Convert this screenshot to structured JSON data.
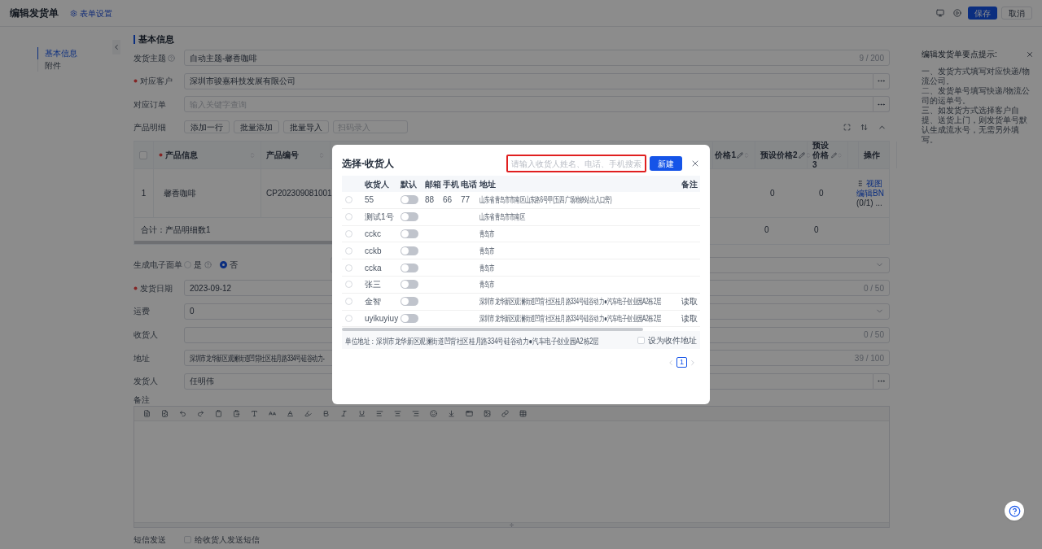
{
  "header": {
    "title": "编辑发货单",
    "settings_link": "表单设置",
    "save": "保存",
    "cancel": "取消"
  },
  "nav": [
    {
      "label": "基本信息",
      "selected": true
    },
    {
      "label": "附件",
      "selected": false
    }
  ],
  "section_title": "基本信息",
  "top_fields": [
    {
      "kind": "text",
      "label": "发货主题",
      "required": false,
      "help": true,
      "value": "自动主题-馨香咖啡",
      "counter": "9 / 200"
    },
    {
      "kind": "lookup",
      "label": "对应客户",
      "required": true,
      "help": false,
      "value": "深圳市骏嘉科技发展有限公司"
    },
    {
      "kind": "lookup",
      "label": "对应订单",
      "required": false,
      "help": false,
      "placeholder": "输入关键字查询"
    }
  ],
  "products": {
    "label": "产品明细",
    "select_all_checked": false,
    "buttons": [
      "添加一行",
      "批量添加",
      "批量导入"
    ],
    "scan_placeholder": "扫码录入",
    "columns": [
      {
        "label": "产品信息",
        "required": true
      },
      {
        "label": "产品编号",
        "required": false
      },
      {
        "label": "价格1"
      },
      {
        "label": "预设价格2"
      },
      {
        "label": "预设价格3"
      },
      {
        "label": "操作"
      }
    ],
    "rows": [
      {
        "index": "1",
        "product": "馨香咖啡",
        "code": "CP202309081001",
        "price2": "0",
        "price3": "0",
        "actions": [
          "视图",
          "编辑BN"
        ],
        "count": "(0/1)",
        "more": "..."
      }
    ],
    "footer": {
      "label": "合计：产品明细数1",
      "price2": "0",
      "price3": "0"
    }
  },
  "bottom_fields": [
    {
      "kind": "radio",
      "label": "生成电子面单",
      "required": false,
      "options": [
        {
          "label": "是",
          "help": true,
          "selected": false
        },
        {
          "label": "否",
          "help": false,
          "selected": true
        }
      ]
    },
    {
      "kind": "text",
      "label": "发货日期",
      "required": true,
      "value": "2023-09-12",
      "counter": "0 / 50"
    },
    {
      "kind": "select",
      "label": "运费",
      "required": false,
      "value": "0"
    },
    {
      "kind": "text",
      "label": "收货人",
      "required": false,
      "counter": "0 / 50"
    },
    {
      "kind": "text",
      "label": "地址",
      "required": false,
      "value": "深圳市龙华新区观澜街道凹背社区桂月路334号硅谷动力-",
      "counter": "39 / 100"
    },
    {
      "kind": "lookup",
      "label": "发货人",
      "required": false,
      "value": "任明伟"
    }
  ],
  "remark": {
    "label": "备注"
  },
  "sms": {
    "label": "短信发送",
    "checkbox_label": "给收货人发送短信",
    "checked": false
  },
  "tips": {
    "title": "编辑发货单要点提示:",
    "paragraphs": [
      "一、发货方式填写对应快递/物流公司。",
      "二、发货单号填写快递/物流公司的运单号。",
      "三、如发货方式选择客户自提、送货上门，则发货单号默认生成流水号，无需另外填写。"
    ]
  },
  "modal": {
    "title": "选择-收货人",
    "search_placeholder": "请输入收货人姓名、电话、手机搜索",
    "new_button": "新建",
    "columns": [
      "收货人",
      "默认",
      "邮箱",
      "手机",
      "电话",
      "地址",
      "备注"
    ],
    "rows": [
      {
        "name": "55",
        "default": false,
        "email": "88",
        "mobile": "66",
        "phone": "77",
        "address": "山东省青岛市市南区山东路6号甲(五四广场地铁站出入口旁)",
        "selected": false
      },
      {
        "name": "测试1号",
        "default": false,
        "address": "山东省青岛市市南区",
        "selected": false
      },
      {
        "name": "cckc",
        "default": false,
        "address": "青岛市",
        "selected": false
      },
      {
        "name": "cckb",
        "default": false,
        "address": "青岛市",
        "selected": false
      },
      {
        "name": "ccka",
        "default": false,
        "address": "青岛市",
        "selected": false
      },
      {
        "name": "张三",
        "default": false,
        "address": "青岛市",
        "selected": false
      },
      {
        "name": "金智",
        "default": false,
        "address": "深圳市龙华新区观澜街道凹背社区桂月路334号硅谷动力●汽车电子创业园A2栋2层",
        "remark": "读取",
        "selected": false
      },
      {
        "name": "uyikuyiuy",
        "default": false,
        "address": "深圳市龙华新区观澜街道凹背社区桂月路334号硅谷动力●汽车电子创业园A2栋2层",
        "remark": "读取",
        "selected": false
      }
    ],
    "unit_address": "单位地址：深圳市龙华新区观澜街道凹背社区桂月路334号硅谷动力●汽车电子创业园A2栋2层",
    "set_address_label": "设为收件地址",
    "set_address_checked": false,
    "pages": [
      {
        "label": "1",
        "selected": true
      }
    ]
  }
}
